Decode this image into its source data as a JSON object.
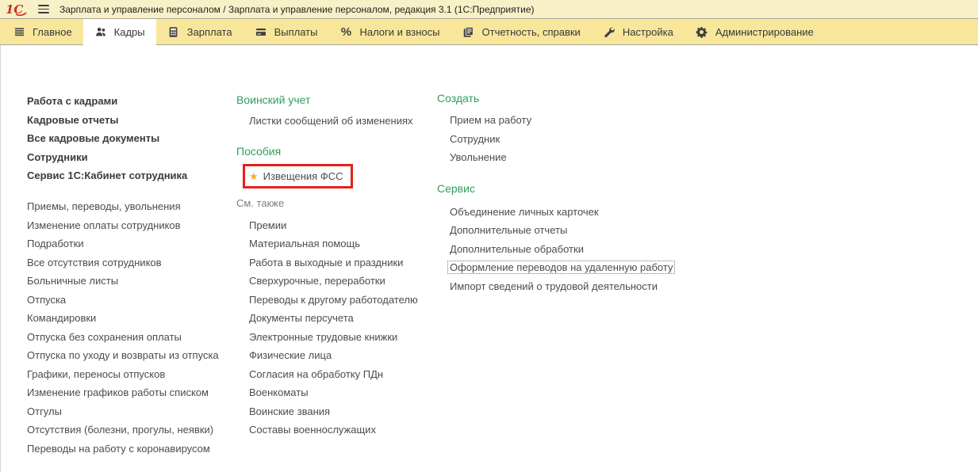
{
  "titlebar": {
    "logo": "1С",
    "title": "Зарплата и управление персоналом / Зарплата и управление персоналом, редакция 3.1  (1С:Предприятие)"
  },
  "tabs": [
    {
      "label": "Главное"
    },
    {
      "label": "Кадры"
    },
    {
      "label": "Зарплата"
    },
    {
      "label": "Выплаты"
    },
    {
      "label": "Налоги и взносы"
    },
    {
      "label": "Отчетность, справки"
    },
    {
      "label": "Настройка"
    },
    {
      "label": "Администрирование"
    }
  ],
  "percent_glyph": "%",
  "nav": {
    "left": {
      "bold_items": [
        "Работа с кадрами",
        "Кадровые отчеты",
        "Все кадровые документы",
        "Сотрудники",
        "Сервис 1С:Кабинет сотрудника"
      ],
      "items": [
        "Приемы, переводы, увольнения",
        "Изменение оплаты сотрудников",
        "Подработки",
        "Все отсутствия сотрудников",
        "Больничные листы",
        "Отпуска",
        "Командировки",
        "Отпуска без сохранения оплаты",
        "Отпуска по уходу и возвраты из отпуска",
        "Графики, переносы отпусков",
        "Изменение графиков работы списком",
        "Отгулы",
        "Отсутствия (болезни, прогулы, неявки)",
        "Переводы на работу с коронавирусом"
      ]
    },
    "middle": {
      "military": {
        "header": "Воинский учет",
        "items": [
          "Листки сообщений об изменениях"
        ]
      },
      "benefits": {
        "header": "Пособия",
        "starred_item": "Извещения ФСС",
        "star_icon": "★"
      },
      "see_also": {
        "header": "См. также",
        "items": [
          "Премии",
          "Материальная помощь",
          "Работа в выходные и праздники",
          "Сверхурочные, переработки",
          "Переводы к другому работодателю",
          "Документы персучета",
          "Электронные трудовые книжки",
          "Физические лица",
          "Согласия на обработку ПДн",
          "Военкоматы",
          "Воинские звания",
          "Составы военнослужащих"
        ]
      }
    },
    "right": {
      "create": {
        "header": "Создать",
        "items": [
          "Прием на работу",
          "Сотрудник",
          "Увольнение"
        ]
      },
      "service": {
        "header": "Сервис",
        "items": [
          "Объединение личных карточек",
          "Дополнительные отчеты",
          "Дополнительные обработки",
          "Оформление переводов на удаленную работу",
          "Импорт сведений о трудовой деятельности"
        ]
      }
    }
  },
  "colors": {
    "titlebar_yellow": "#f8f0c6",
    "tabbar_yellow": "#f8e79b",
    "accent_green": "#2f9e59",
    "highlight_red": "#e3211c",
    "star_gold": "#f0ad1e",
    "logo_red": "#cf2b1d"
  }
}
